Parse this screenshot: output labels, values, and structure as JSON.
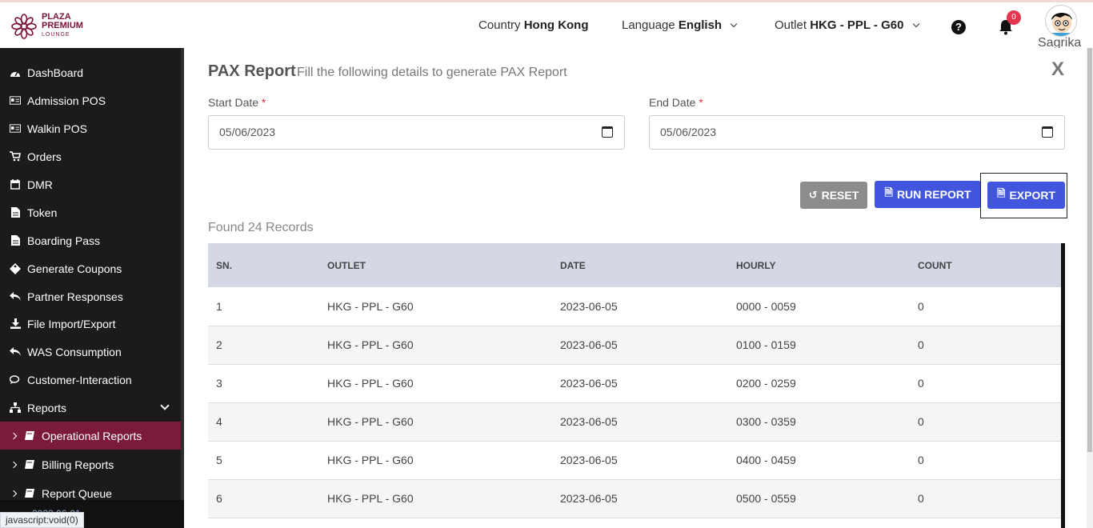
{
  "header": {
    "logo_line1": "PLAZA",
    "logo_line2": "PREMIUM",
    "logo_line3": "LOUNGE",
    "country_label": "Country",
    "country_value": "Hong Kong",
    "language_label": "Language",
    "language_value": "English",
    "outlet_label": "Outlet",
    "outlet_value": "HKG - PPL - G60",
    "help_icon": "question-circle-icon",
    "notification_count": "0",
    "user_name": "Sagrika"
  },
  "sidebar": {
    "items": [
      {
        "label": "DashBoard",
        "icon": "dashboard-icon"
      },
      {
        "label": "Admission POS",
        "icon": "id-card-icon"
      },
      {
        "label": "Walkin POS",
        "icon": "id-card-icon"
      },
      {
        "label": "Orders",
        "icon": "cart-icon"
      },
      {
        "label": "DMR",
        "icon": "calendar-icon"
      },
      {
        "label": "Token",
        "icon": "file-icon"
      },
      {
        "label": "Boarding Pass",
        "icon": "file-icon"
      },
      {
        "label": "Generate Coupons",
        "icon": "ticket-icon"
      },
      {
        "label": "Partner Responses",
        "icon": "reply-icon"
      },
      {
        "label": "File Import/Export",
        "icon": "download-icon"
      },
      {
        "label": "WAS Consumption",
        "icon": "reply-icon"
      },
      {
        "label": "Customer-Interaction",
        "icon": "chat-icon"
      },
      {
        "label": "Reports",
        "icon": "sitemap-icon"
      }
    ],
    "subitems": [
      {
        "label": "Operational Reports",
        "active": true
      },
      {
        "label": "Billing Reports",
        "active": false
      },
      {
        "label": "Report Queue",
        "active": false
      }
    ],
    "version": "2023.06-01",
    "status_url": "javascript:void(0)"
  },
  "form": {
    "title": "PAX Report",
    "subtitle": "Fill the following details to generate PAX Report",
    "close_label": "X",
    "start_date_label": "Start Date",
    "start_date_value": "05/06/2023",
    "end_date_label": "End Date",
    "end_date_value": "05/06/2023",
    "required_mark": "*",
    "reset_label": "RESET",
    "run_label": "RUN REPORT",
    "export_label": "EXPORT",
    "found_text": "Found 24 Records"
  },
  "table": {
    "columns": [
      "SN.",
      "OUTLET",
      "DATE",
      "HOURLY",
      "COUNT"
    ],
    "rows": [
      [
        "1",
        "HKG - PPL - G60",
        "2023-06-05",
        "0000 - 0059",
        "0"
      ],
      [
        "2",
        "HKG - PPL - G60",
        "2023-06-05",
        "0100 - 0159",
        "0"
      ],
      [
        "3",
        "HKG - PPL - G60",
        "2023-06-05",
        "0200 - 0259",
        "0"
      ],
      [
        "4",
        "HKG - PPL - G60",
        "2023-06-05",
        "0300 - 0359",
        "0"
      ],
      [
        "5",
        "HKG - PPL - G60",
        "2023-06-05",
        "0400 - 0459",
        "0"
      ],
      [
        "6",
        "HKG - PPL - G60",
        "2023-06-05",
        "0500 - 0559",
        "0"
      ]
    ]
  },
  "colors": {
    "brand": "#7b1238",
    "sidebar_bg": "#1b1b1b",
    "active_item": "#7c1a3c",
    "primary_button": "#4156dc",
    "reset_button": "#8c8c8c",
    "table_header": "#d4d8e4"
  }
}
